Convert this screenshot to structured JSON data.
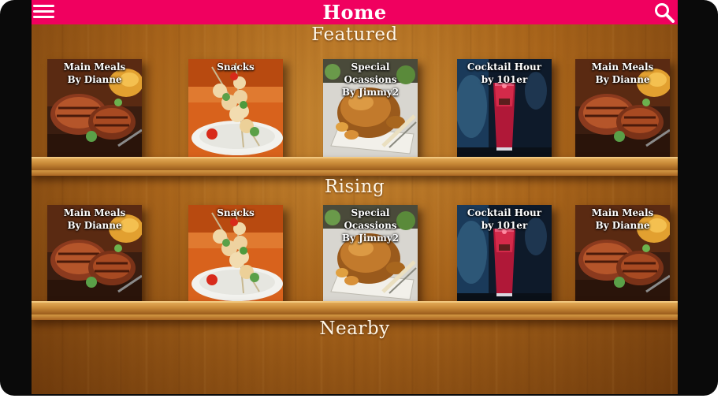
{
  "header": {
    "title": "Home",
    "menu_icon": "menu-icon",
    "search_icon": "search-icon"
  },
  "colors": {
    "header_bg": "#f0005f",
    "text": "#ffffff"
  },
  "sections": [
    {
      "title": "Featured",
      "items": [
        {
          "line1": "Main Meals",
          "line2": "By Dianne",
          "image": "steak"
        },
        {
          "line1": "Snacks",
          "line2": "",
          "image": "skewers"
        },
        {
          "line1": "Special Ocassions",
          "line2": "By Jimmy2",
          "image": "roast-chicken"
        },
        {
          "line1": "Cocktail Hour",
          "line2": "by 101er",
          "image": "cocktail"
        },
        {
          "line1": "Main Meals",
          "line2": "By Dianne",
          "image": "steak"
        }
      ]
    },
    {
      "title": "Rising",
      "items": [
        {
          "line1": "Main Meals",
          "line2": "By Dianne",
          "image": "steak"
        },
        {
          "line1": "Snacks",
          "line2": "",
          "image": "skewers"
        },
        {
          "line1": "Special Ocassions",
          "line2": "By Jimmy2",
          "image": "roast-chicken"
        },
        {
          "line1": "Cocktail Hour",
          "line2": "by 101er",
          "image": "cocktail"
        },
        {
          "line1": "Main Meals",
          "line2": "By Dianne",
          "image": "steak"
        }
      ]
    },
    {
      "title": "Nearby",
      "items": []
    }
  ]
}
